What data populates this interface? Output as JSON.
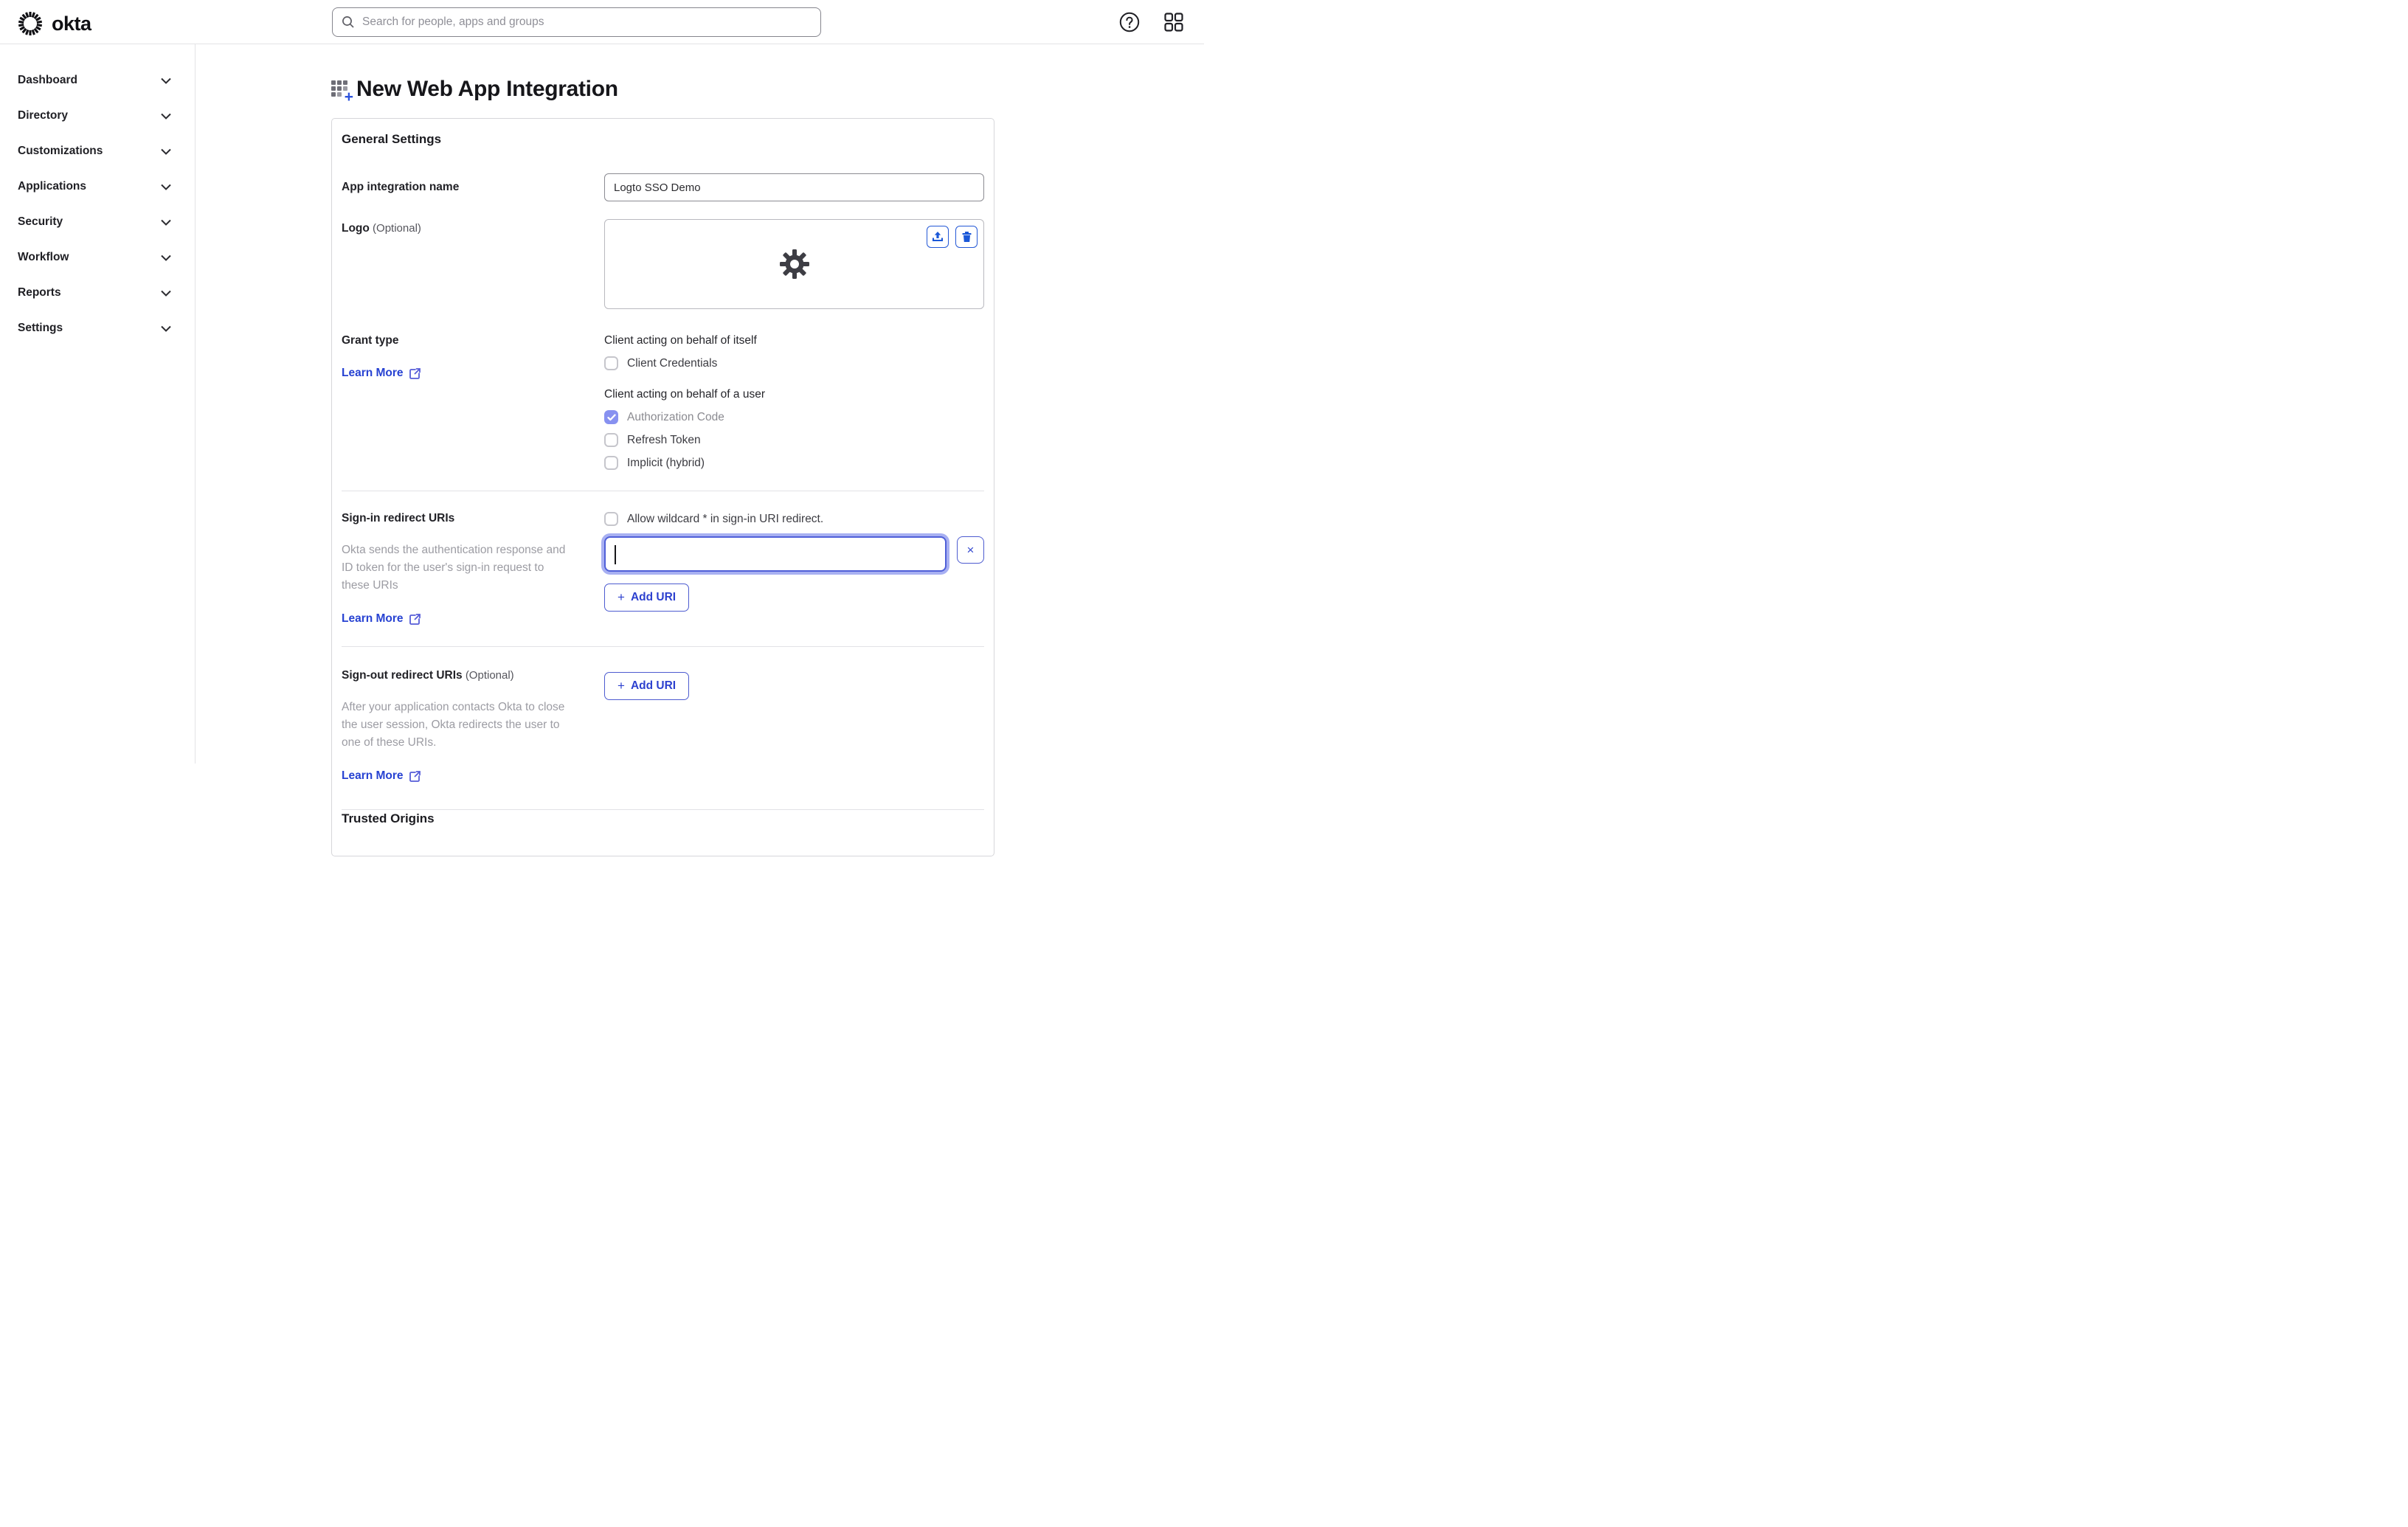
{
  "header": {
    "brand": "okta",
    "search_placeholder": "Search for people, apps and groups"
  },
  "sidebar": {
    "items": [
      {
        "label": "Dashboard"
      },
      {
        "label": "Directory"
      },
      {
        "label": "Customizations"
      },
      {
        "label": "Applications"
      },
      {
        "label": "Security"
      },
      {
        "label": "Workflow"
      },
      {
        "label": "Reports"
      },
      {
        "label": "Settings"
      }
    ]
  },
  "page": {
    "title": "New Web App Integration"
  },
  "general": {
    "heading": "General Settings",
    "app_name": {
      "label": "App integration name",
      "value": "Logto SSO Demo"
    },
    "logo": {
      "label": "Logo",
      "optional": "(Optional)"
    },
    "grant": {
      "label": "Grant type",
      "learn_more": "Learn More",
      "group1_heading": "Client acting on behalf of itself",
      "group1_option1": "Client Credentials",
      "group2_heading": "Client acting on behalf of a user",
      "group2_option1": "Authorization Code",
      "group2_option1_checked": true,
      "group2_option2": "Refresh Token",
      "group2_option3": "Implicit (hybrid)"
    },
    "sign_in": {
      "label": "Sign-in redirect URIs",
      "wildcard_label": "Allow wildcard * in sign-in URI redirect.",
      "wildcard_checked": false,
      "help": "Okta sends the authentication response and ID token for the user's sign-in request to these URIs",
      "learn_more": "Learn More",
      "uri_value": "",
      "add_uri": "Add URI"
    },
    "sign_out": {
      "label": "Sign-out redirect URIs",
      "optional": "(Optional)",
      "help": "After your application contacts Okta to close the user session, Okta redirects the user to one of these URIs.",
      "learn_more": "Learn More",
      "add_uri": "Add URI"
    }
  },
  "trusted_origins": {
    "heading": "Trusted Origins"
  },
  "glyphs": {
    "plus": "+",
    "close": "×"
  },
  "colors": {
    "link_blue": "#2742d2",
    "button_border_blue": "#4d5bd0",
    "icon_blue": "#2458d6",
    "checkbox_checked": "#8791f0",
    "focus_border": "#4f5fd8",
    "focus_ring": "#8b96ee",
    "text_dark": "#1d1d21",
    "help_gray": "#9c9ca3",
    "border_gray": "#d6d6da"
  }
}
